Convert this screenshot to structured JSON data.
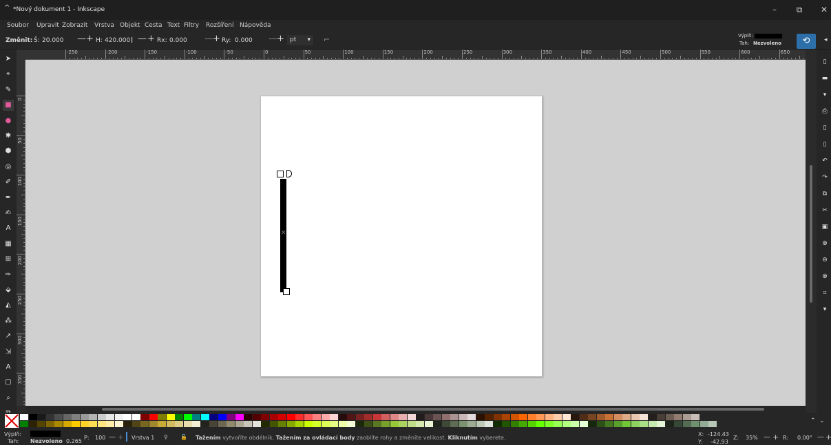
{
  "window": {
    "title": "*Nový dokument 1 - Inkscape",
    "app_icon": "inkscape-icon",
    "controls": {
      "minimize": "–",
      "maximize": "⧉",
      "close": "✕"
    }
  },
  "menu": [
    "Soubor",
    "Upravit",
    "Zobrazit",
    "Vrstva",
    "Objekt",
    "Cesta",
    "Text",
    "Filtry",
    "Rozšíření",
    "Nápověda"
  ],
  "tool_controls": {
    "change_label": "Změnit:",
    "w_label": "Š:",
    "w_value": "20.000",
    "h_label": "H:",
    "h_value": "420.000",
    "rx_label": "Rx:",
    "rx_value": "0.000",
    "ry_label": "Ry:",
    "ry_value": "0.000",
    "unit": "pt",
    "minus": "—",
    "plus": "+",
    "lock_glyph": "I",
    "corner_glyph": "⌐"
  },
  "style_indicator": {
    "fill_label": "Výplň:",
    "stroke_label": "Tah:",
    "stroke_value": "Nezvoleno",
    "fill_color": "#000000"
  },
  "rulers": {
    "horizontal_labels": [
      "-250",
      "-200",
      "-150",
      "-100",
      "-50",
      "0",
      "50",
      "100",
      "150",
      "200",
      "250",
      "300",
      "350",
      "400",
      "450",
      "500",
      "550",
      "600",
      "650"
    ],
    "vertical_labels": [
      "0",
      "50",
      "100",
      "150",
      "200",
      "250",
      "300",
      "350"
    ]
  },
  "left_toolbar": [
    {
      "name": "selector-tool-icon",
      "glyph": "➤"
    },
    {
      "name": "node-tool-icon",
      "glyph": "⌖"
    },
    {
      "name": "tweak-tool-icon",
      "glyph": "✎"
    },
    {
      "name": "rect-tool-icon",
      "glyph": "■"
    },
    {
      "name": "ellipse-tool-icon",
      "glyph": "●"
    },
    {
      "name": "star-tool-icon",
      "glyph": "✱"
    },
    {
      "name": "3dbox-tool-icon",
      "glyph": "⬢"
    },
    {
      "name": "spiral-tool-icon",
      "glyph": "◎"
    },
    {
      "name": "pencil-tool-icon",
      "glyph": "✐"
    },
    {
      "name": "pen-tool-icon",
      "glyph": "✒"
    },
    {
      "name": "calligraphy-tool-icon",
      "glyph": "✍"
    },
    {
      "name": "text-tool-icon",
      "glyph": "A"
    },
    {
      "name": "gradient-tool-icon",
      "glyph": "▦"
    },
    {
      "name": "mesh-tool-icon",
      "glyph": "⊞"
    },
    {
      "name": "dropper-tool-icon",
      "glyph": "✑"
    },
    {
      "name": "paint-bucket-tool-icon",
      "glyph": "⬙"
    },
    {
      "name": "eraser-tool-icon",
      "glyph": "◭"
    },
    {
      "name": "spray-tool-icon",
      "glyph": "⁂"
    },
    {
      "name": "connector-tool-icon",
      "glyph": "↗"
    },
    {
      "name": "measure-tool-icon",
      "glyph": "⇲"
    },
    {
      "name": "text-toolbox-icon",
      "glyph": "A"
    },
    {
      "name": "page-tool-icon",
      "glyph": "▢"
    },
    {
      "name": "zoom-tool-icon",
      "glyph": "⌕"
    },
    {
      "name": "pages-tool-icon",
      "glyph": "⧉"
    }
  ],
  "right_toolbar": [
    {
      "name": "new-document-icon",
      "glyph": "▯"
    },
    {
      "name": "open-document-icon",
      "glyph": "▬"
    },
    {
      "name": "save-document-icon",
      "glyph": "▾"
    },
    {
      "name": "print-icon",
      "glyph": "⎙"
    },
    {
      "name": "import-icon",
      "glyph": "▯"
    },
    {
      "name": "export-icon",
      "glyph": "▯"
    },
    {
      "name": "undo-icon",
      "glyph": "↶"
    },
    {
      "name": "redo-icon",
      "glyph": "↷"
    },
    {
      "name": "copy-icon",
      "glyph": "⧉"
    },
    {
      "name": "cut-icon",
      "glyph": "✂"
    },
    {
      "name": "paste-icon",
      "glyph": "▣"
    },
    {
      "name": "zoom-selection-icon",
      "glyph": "⊕"
    },
    {
      "name": "zoom-drawing-icon",
      "glyph": "⊖"
    },
    {
      "name": "zoom-page-icon",
      "glyph": "⊗"
    },
    {
      "name": "zoom-fit-icon",
      "glyph": "⌗"
    },
    {
      "name": "more-icon",
      "glyph": "▾"
    }
  ],
  "palette": {
    "colors": [
      "#ffffff",
      "#000000",
      "#1a1a1a",
      "#333333",
      "#4d4d4d",
      "#666666",
      "#808080",
      "#999999",
      "#b3b3b3",
      "#cccccc",
      "#e6e6e6",
      "#f2f2f2",
      "#ffffff",
      "#ffffff",
      "#800000",
      "#ff0000",
      "#808000",
      "#ffff00",
      "#008000",
      "#00ff00",
      "#008080",
      "#00ffff",
      "#000080",
      "#0000ff",
      "#800080",
      "#ff00ff",
      "#2b0000",
      "#550000",
      "#800000",
      "#aa0000",
      "#d40000",
      "#ff0000",
      "#ff2a2a",
      "#ff5555",
      "#ff8080",
      "#ffaaaa",
      "#ffd5d5",
      "#280b0b",
      "#501616",
      "#782121",
      "#a02c2c",
      "#c83737",
      "#d35f5f",
      "#de8787",
      "#e9afaf",
      "#f4d7d7",
      "#241c1c",
      "#483737",
      "#6c5353",
      "#916f6f",
      "#ac9393",
      "#c8b7b7",
      "#e3dbdb",
      "#2b1100",
      "#552200",
      "#803300",
      "#aa4400",
      "#d45500",
      "#ff6600",
      "#ff7f2a",
      "#ff9955",
      "#ffb380",
      "#ffccaa",
      "#ffe6d5",
      "#28170b",
      "#502d16",
      "#784421",
      "#a05a2c",
      "#c87137",
      "#d38d5f",
      "#deaa87",
      "#e9c6af",
      "#f4e3d7",
      "#241f1c",
      "#483e37",
      "#6c5d53",
      "#917c6f",
      "#ac9d93",
      "#c8beb7"
    ],
    "colors_row2": [
      "#008000",
      "#2b2200",
      "#554400",
      "#806600",
      "#aa8800",
      "#d4aa00",
      "#ffcc00",
      "#ffd42a",
      "#ffdd55",
      "#ffe680",
      "#ffeeaa",
      "#fff6d5",
      "#28220b",
      "#504416",
      "#786721",
      "#a0892c",
      "#c8ab37",
      "#d3bc5f",
      "#decd87",
      "#e9ddaf",
      "#f4eed7",
      "#24221c",
      "#484537",
      "#6c6753",
      "#918a6f",
      "#aca793",
      "#c8c4b7",
      "#e3e2db",
      "#222b00",
      "#445500",
      "#668000",
      "#88aa00",
      "#aad400",
      "#ccff00",
      "#d4ff2a",
      "#ddff55",
      "#e5ff80",
      "#eeffaa",
      "#f6ffd5",
      "#1e280b",
      "#3c5016",
      "#5a7821",
      "#78a02c",
      "#96c837",
      "#abd35f",
      "#bfde87",
      "#d5e9af",
      "#eaf4d7",
      "#1f241c",
      "#3e4837",
      "#5d6c53",
      "#7c916f",
      "#9dac93",
      "#bec8b7",
      "#dee3db",
      "#112b00",
      "#225500",
      "#338000",
      "#44aa00",
      "#55d400",
      "#66ff00",
      "#7fff2a",
      "#99ff55",
      "#b3ff80",
      "#ccffaa",
      "#e5ffd5",
      "#16280b",
      "#2d5016",
      "#447821",
      "#5aa02c",
      "#71c837",
      "#8dd35f",
      "#aade87",
      "#c6e9af",
      "#e3f4d7",
      "#1c241c",
      "#374837",
      "#536c53",
      "#6f916f",
      "#93ac93",
      "#b7c8b7"
    ]
  },
  "status": {
    "fill_label": "Výplň:",
    "stroke_label": "Tah:",
    "stroke_value": "Nezvoleno",
    "stroke_width": "0.265",
    "opacity_label": "P:",
    "opacity_value": "100",
    "layer": "Vrstva 1",
    "message_bold1": "Tažením",
    "message_text1": "vytvoříte obdélník.",
    "message_bold2": "Tažením za ovládací body",
    "message_text2": "zaoblíte rohy a změníte velikost.",
    "message_bold3": "Kliknutím",
    "message_text3": "vyberete.",
    "x_label": "X:",
    "x_value": "-124.43",
    "y_label": "Y:",
    "y_value": "-42.93",
    "zoom_label": "Z:",
    "zoom_value": "35%",
    "rotation_label": "R:",
    "rotation_value": "0.00°"
  }
}
